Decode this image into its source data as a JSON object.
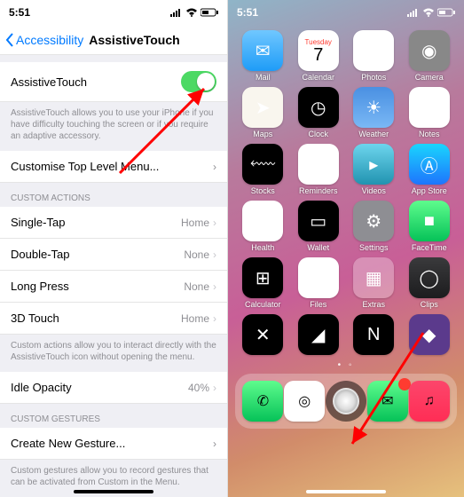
{
  "left": {
    "status_time": "5:51",
    "back_label": "Accessibility",
    "title": "AssistiveTouch",
    "toggle_label": "AssistiveTouch",
    "toggle_on": true,
    "toggle_footer": "AssistiveTouch allows you to use your iPhone if you have difficulty touching the screen or if you require an adaptive accessory.",
    "customise_label": "Customise Top Level Menu...",
    "custom_actions_header": "CUSTOM ACTIONS",
    "actions": [
      {
        "label": "Single-Tap",
        "value": "Home"
      },
      {
        "label": "Double-Tap",
        "value": "None"
      },
      {
        "label": "Long Press",
        "value": "None"
      },
      {
        "label": "3D Touch",
        "value": "Home"
      }
    ],
    "actions_footer": "Custom actions allow you to interact directly with the AssistiveTouch icon without opening the menu.",
    "idle_label": "Idle Opacity",
    "idle_value": "40%",
    "gestures_header": "CUSTOM GESTURES",
    "create_gesture": "Create New Gesture...",
    "gestures_footer": "Custom gestures allow you to record gestures that can be activated from Custom in the Menu."
  },
  "right": {
    "status_time": "5:51",
    "calendar_day": "Tuesday",
    "calendar_date": "7",
    "apps": [
      {
        "n": "Mail",
        "c": "t-mail",
        "g": "✉"
      },
      {
        "n": "Calendar",
        "c": "t-cal",
        "g": ""
      },
      {
        "n": "Photos",
        "c": "t-photos",
        "g": "✿"
      },
      {
        "n": "Camera",
        "c": "t-cam",
        "g": "◉"
      },
      {
        "n": "Maps",
        "c": "t-maps",
        "g": "➤"
      },
      {
        "n": "Clock",
        "c": "t-clock",
        "g": "◷"
      },
      {
        "n": "Weather",
        "c": "t-weather",
        "g": "☀"
      },
      {
        "n": "Notes",
        "c": "t-notes",
        "g": "≣"
      },
      {
        "n": "Stocks",
        "c": "t-stocks",
        "g": "⬳"
      },
      {
        "n": "Reminders",
        "c": "t-rem",
        "g": "≡"
      },
      {
        "n": "Videos",
        "c": "t-videos",
        "g": "▸"
      },
      {
        "n": "App Store",
        "c": "t-appstore",
        "g": "Ⓐ"
      },
      {
        "n": "Health",
        "c": "t-health",
        "g": "♥"
      },
      {
        "n": "Wallet",
        "c": "t-wallet",
        "g": "▭"
      },
      {
        "n": "Settings",
        "c": "t-settings",
        "g": "⚙"
      },
      {
        "n": "FaceTime",
        "c": "t-ft",
        "g": "■"
      },
      {
        "n": "Calculator",
        "c": "t-calc",
        "g": "⊞"
      },
      {
        "n": "Files",
        "c": "t-files",
        "g": "🗀"
      },
      {
        "n": "Extras",
        "c": "t-extras",
        "g": "▦"
      },
      {
        "n": "Clips",
        "c": "t-clips",
        "g": "◯"
      },
      {
        "n": "",
        "c": "t-g1",
        "g": "✕"
      },
      {
        "n": "",
        "c": "t-g2",
        "g": "◢"
      },
      {
        "n": "",
        "c": "t-nf",
        "g": "N"
      },
      {
        "n": "",
        "c": "t-g3",
        "g": "◆"
      }
    ],
    "dock": [
      {
        "n": "Phone",
        "c": "t-phone",
        "g": "✆"
      },
      {
        "n": "Safari",
        "c": "t-safari",
        "g": "◎"
      },
      {
        "n": "Messages",
        "c": "t-msg",
        "g": "✉",
        "badge": true
      },
      {
        "n": "Music",
        "c": "t-music",
        "g": "♫"
      }
    ]
  }
}
